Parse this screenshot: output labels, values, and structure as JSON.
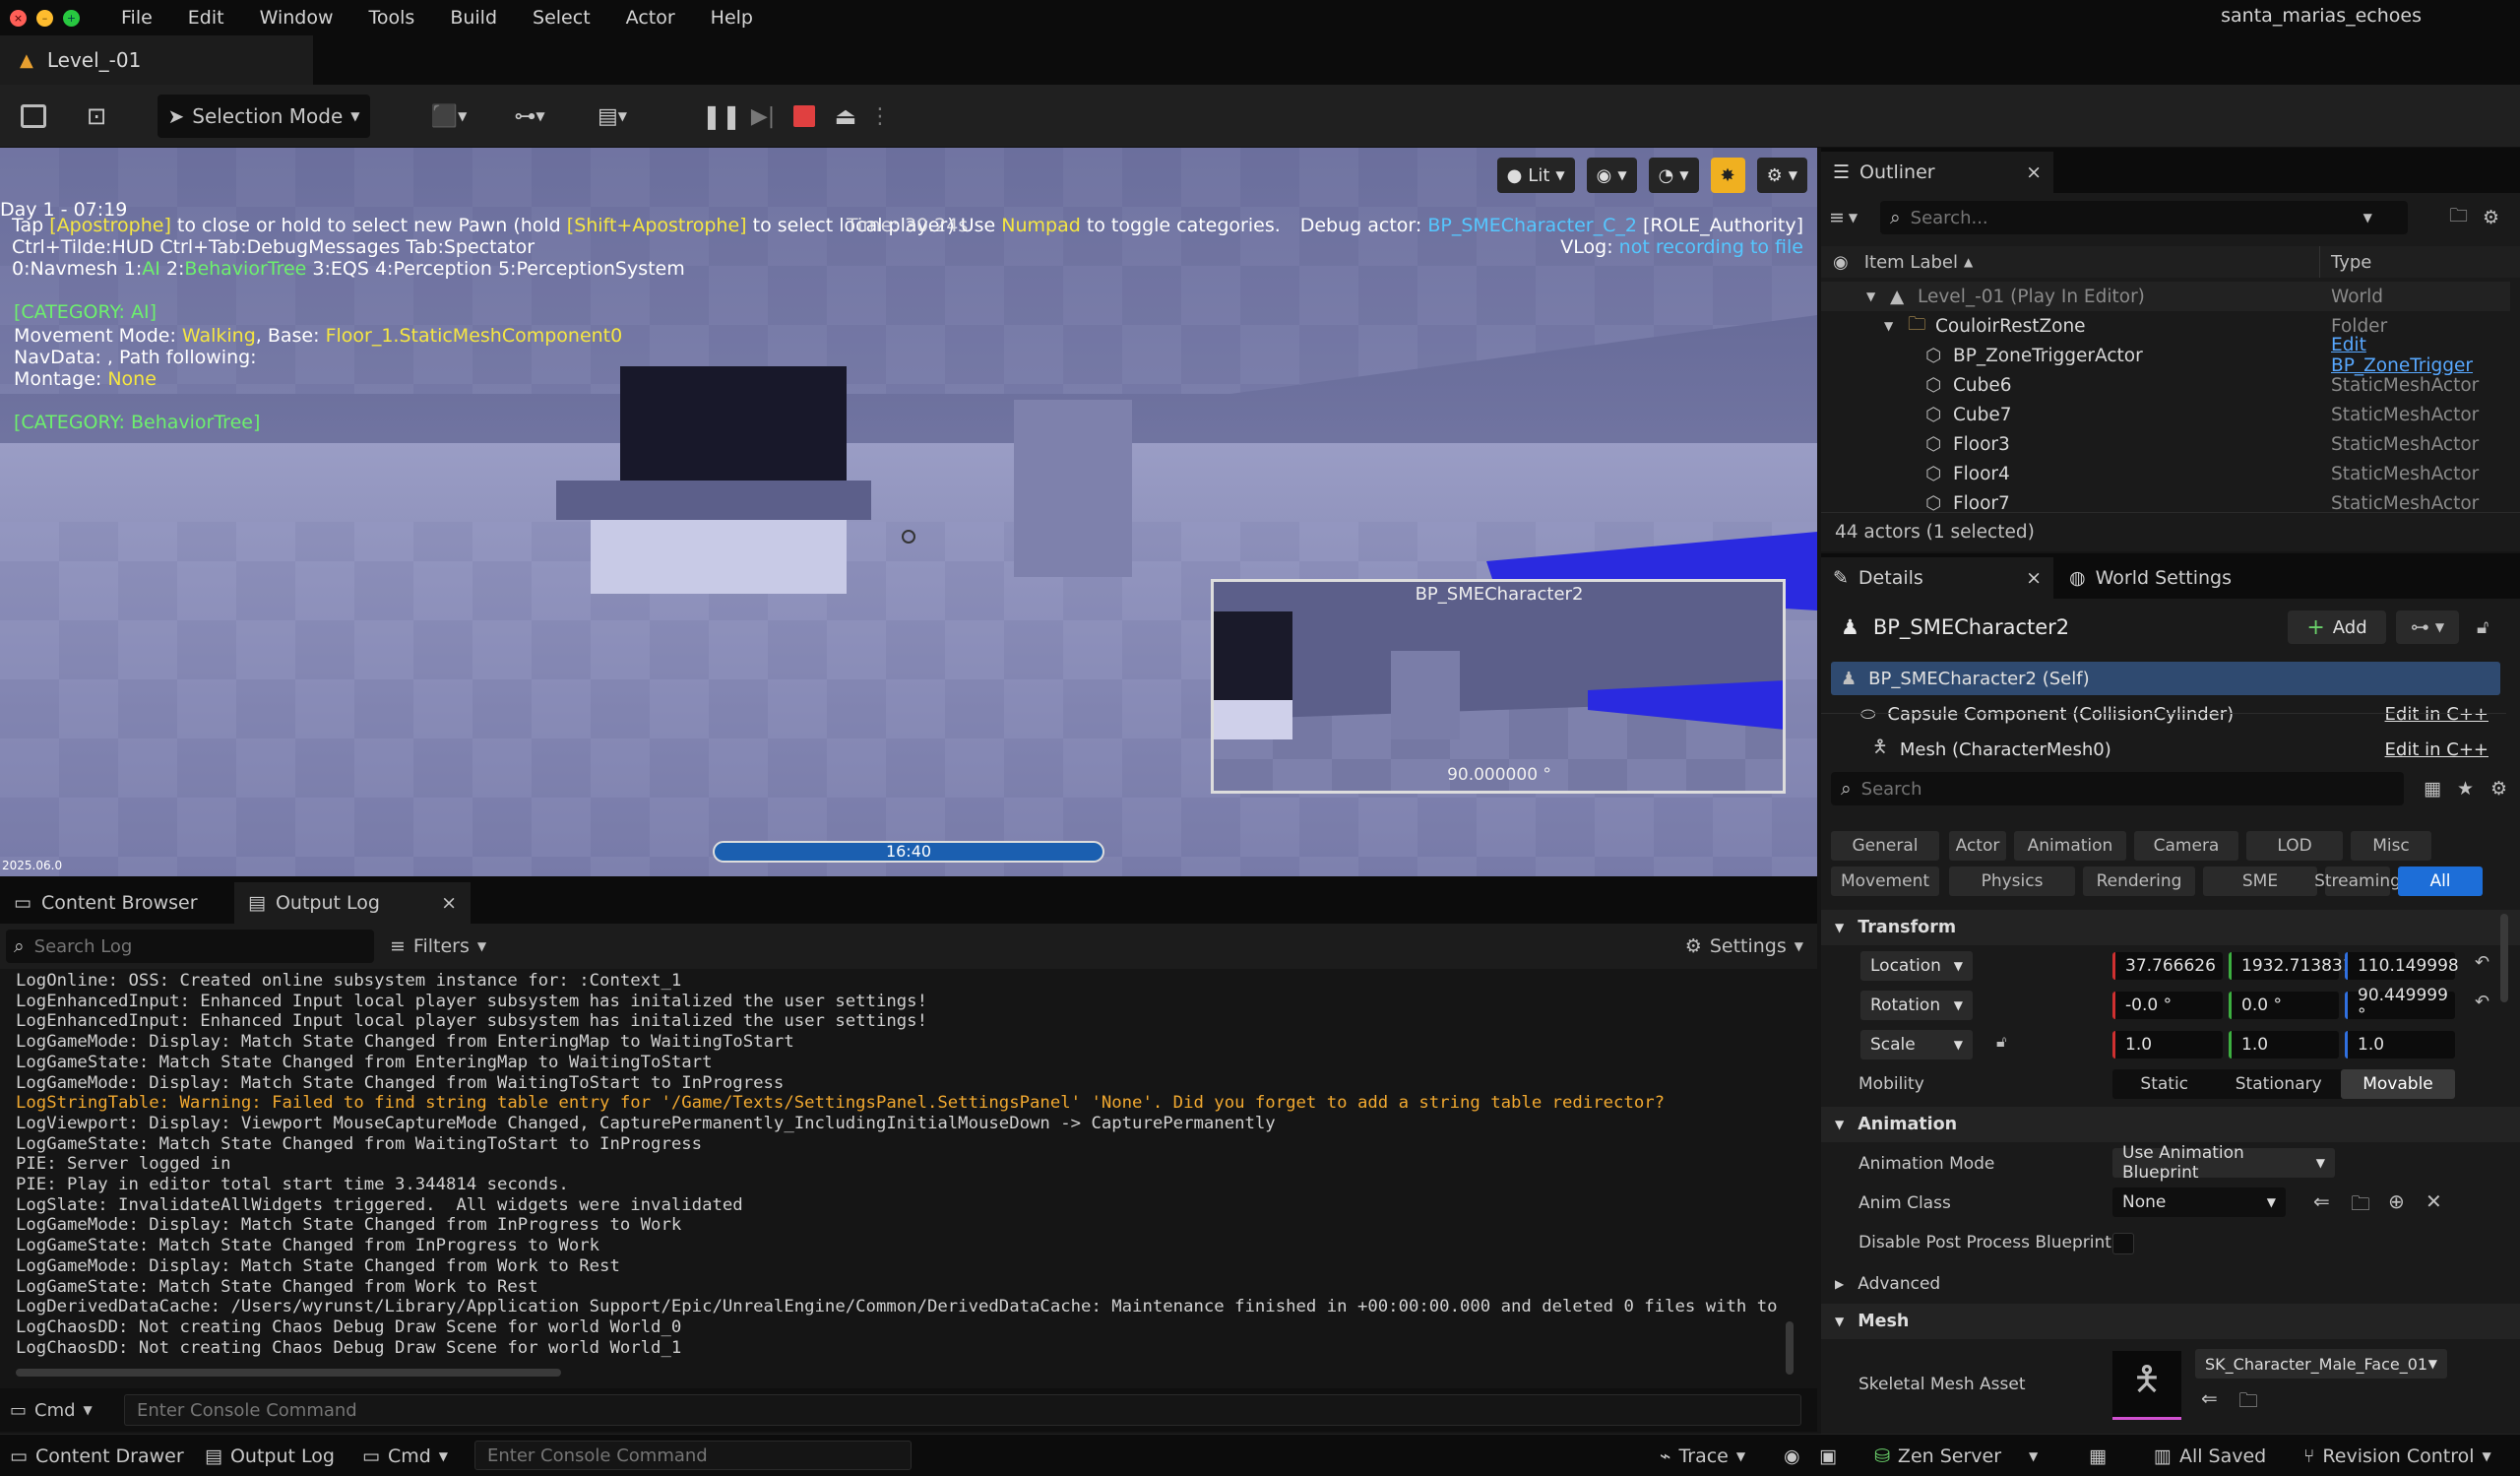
{
  "menu": {
    "items": [
      "File",
      "Edit",
      "Window",
      "Tools",
      "Build",
      "Select",
      "Actor",
      "Help"
    ],
    "app_name": "santa_marias_echoes"
  },
  "level_tab": "Level_-01",
  "toolbar": {
    "selection_mode": "Selection Mode"
  },
  "viewport": {
    "lit_label": "Lit",
    "day_time": "Day 1 - 07:19",
    "debug_line1": {
      "p1": "Tap ",
      "k1": "[Apostrophe]",
      "p2": " to close or hold to select new Pawn (hold ",
      "k2": "[Shift+Apostrophe]",
      "p3": " to select local player)  Use ",
      "k3": "Numpad",
      "p4": " to toggle categories."
    },
    "debug_overlap": "Time: 30.24s",
    "debug_actor_label": "Debug actor: ",
    "debug_actor_name": "BP_SMECharacter_C_2",
    "debug_actor_role": " [ROLE_Authority]",
    "vlog_label": "VLog: ",
    "vlog_value": "not recording to file",
    "keys_line": "Ctrl+Tilde:HUD  Ctrl+Tab:DebugMessages  Tab:Spectator",
    "cat_line": {
      "a": "0:Navmesh  1:",
      "b": "AI",
      "c": "  2:",
      "d": "BehaviorTree",
      "e": "  3:EQS  4:Perception  5:PerceptionSystem"
    },
    "cat_ai": "[CATEGORY: AI]",
    "movement": {
      "label": "Movement Mode: ",
      "mode": "Walking",
      "base_label": ", Base: ",
      "base": "Floor_1.StaticMeshComponent0"
    },
    "navdata": "NavData: , Path following:",
    "montage_label": "Montage: ",
    "montage_value": "None",
    "cat_bt": "[CATEGORY: BehaviorTree]",
    "pip_title": "BP_SMECharacter2",
    "pip_angle": "90.000000 °",
    "timer": "16:40",
    "version": "2025.06.0"
  },
  "lower_tabs": {
    "content_browser": "Content Browser",
    "output_log": "Output Log"
  },
  "log": {
    "search_placeholder": "Search Log",
    "filters": "Filters",
    "settings": "Settings",
    "lines": [
      {
        "text": "LogOnline: OSS: Created online subsystem instance for: :Context_1",
        "type": "normal"
      },
      {
        "text": "LogEnhancedInput: Enhanced Input local player subsystem has initalized the user settings!",
        "type": "normal"
      },
      {
        "text": "LogEnhancedInput: Enhanced Input local player subsystem has initalized the user settings!",
        "type": "normal"
      },
      {
        "text": "LogGameMode: Display: Match State Changed from EnteringMap to WaitingToStart",
        "type": "normal"
      },
      {
        "text": "LogGameState: Match State Changed from EnteringMap to WaitingToStart",
        "type": "normal"
      },
      {
        "text": "LogGameMode: Display: Match State Changed from WaitingToStart to InProgress",
        "type": "normal"
      },
      {
        "text": "LogStringTable: Warning: Failed to find string table entry for '/Game/Texts/SettingsPanel.SettingsPanel' 'None'. Did you forget to add a string table redirector?",
        "type": "warn"
      },
      {
        "text": "LogViewport: Display: Viewport MouseCaptureMode Changed, CapturePermanently_IncludingInitialMouseDown -> CapturePermanently",
        "type": "normal"
      },
      {
        "text": "LogGameState: Match State Changed from WaitingToStart to InProgress",
        "type": "normal"
      },
      {
        "text": "PIE: Server logged in",
        "type": "normal"
      },
      {
        "text": "PIE: Play in editor total start time 3.344814 seconds.",
        "type": "normal"
      },
      {
        "text": "LogSlate: InvalidateAllWidgets triggered.  All widgets were invalidated",
        "type": "normal"
      },
      {
        "text": "LogGameMode: Display: Match State Changed from InProgress to Work",
        "type": "normal"
      },
      {
        "text": "LogGameState: Match State Changed from InProgress to Work",
        "type": "normal"
      },
      {
        "text": "LogGameMode: Display: Match State Changed from Work to Rest",
        "type": "normal"
      },
      {
        "text": "LogGameState: Match State Changed from Work to Rest",
        "type": "normal"
      },
      {
        "text": "LogDerivedDataCache: /Users/wyrunst/Library/Application Support/Epic/UnrealEngine/Common/DerivedDataCache: Maintenance finished in +00:00:00.000 and deleted 0 files with to",
        "type": "normal"
      },
      {
        "text": "LogChaosDD: Not creating Chaos Debug Draw Scene for world World_0",
        "type": "normal"
      },
      {
        "text": "LogChaosDD: Not creating Chaos Debug Draw Scene for world World_1",
        "type": "normal"
      }
    ],
    "cmd_label": "Cmd",
    "cmd_placeholder": "Enter Console Command"
  },
  "statusbar": {
    "content_drawer": "Content Drawer",
    "output_log": "Output Log",
    "cmd": "Cmd",
    "cmd_placeholder": "Enter Console Command",
    "trace": "Trace",
    "zen_server": "Zen Server",
    "all_saved": "All Saved",
    "revision_control": "Revision Control"
  },
  "outliner": {
    "title": "Outliner",
    "search_placeholder": "Search...",
    "col_label": "Item Label",
    "col_type": "Type",
    "rows": [
      {
        "label": "Level_-01 (Play In Editor)",
        "type": "World",
        "indent": 0,
        "dim": true
      },
      {
        "label": "CouloirRestZone",
        "type": "Folder",
        "indent": 1,
        "dim": false
      },
      {
        "label": "BP_ZoneTriggerActor",
        "type": "Edit BP_ZoneTrigger",
        "indent": 2,
        "dim": false,
        "link": true
      },
      {
        "label": "Cube6",
        "type": "StaticMeshActor",
        "indent": 2,
        "dim": false
      },
      {
        "label": "Cube7",
        "type": "StaticMeshActor",
        "indent": 2,
        "dim": false
      },
      {
        "label": "Floor3",
        "type": "StaticMeshActor",
        "indent": 2,
        "dim": false
      },
      {
        "label": "Floor4",
        "type": "StaticMeshActor",
        "indent": 2,
        "dim": false
      },
      {
        "label": "Floor7",
        "type": "StaticMeshActor",
        "indent": 2,
        "dim": false
      }
    ],
    "count": "44 actors (1 selected)"
  },
  "details": {
    "tab": "Details",
    "world_settings_tab": "World Settings",
    "actor_name": "BP_SMECharacter2",
    "add_label": "Add",
    "components": [
      {
        "label": "BP_SMECharacter2 (Self)",
        "edit": ""
      },
      {
        "label": "Capsule Component (CollisionCylinder)",
        "edit": "Edit in C++"
      },
      {
        "label": "Mesh (CharacterMesh0)",
        "edit": "Edit in C++"
      }
    ],
    "search_placeholder": "Search",
    "categories_row1": [
      "General",
      "Actor",
      "Animation",
      "Camera",
      "LOD",
      "Misc"
    ],
    "categories_row2": [
      "Movement",
      "Physics",
      "Rendering",
      "SME",
      "Streaming",
      "All"
    ],
    "transform": {
      "title": "Transform",
      "location_label": "Location",
      "location": [
        "37.766626",
        "1932.713831",
        "110.149998"
      ],
      "rotation_label": "Rotation",
      "rotation": [
        "-0.0 °",
        "0.0 °",
        "90.449999 °"
      ],
      "scale_label": "Scale",
      "scale": [
        "1.0",
        "1.0",
        "1.0"
      ],
      "mobility_label": "Mobility",
      "mobility": [
        "Static",
        "Stationary",
        "Movable"
      ]
    },
    "animation": {
      "title": "Animation",
      "mode_label": "Animation Mode",
      "mode_value": "Use Animation Blueprint",
      "class_label": "Anim Class",
      "class_value": "None",
      "disable_pp_label": "Disable Post Process Blueprint",
      "advanced": "Advanced"
    },
    "mesh": {
      "title": "Mesh",
      "skeletal_label": "Skeletal Mesh Asset",
      "skeletal_value": "SK_Character_Male_Face_01"
    }
  },
  "colors": {
    "accent": "#1d6ed8",
    "selected_row": "#2f4a70",
    "warning": "#f0a830",
    "debug_yellow": "#f5e642",
    "debug_cyan": "#55c7ff"
  }
}
